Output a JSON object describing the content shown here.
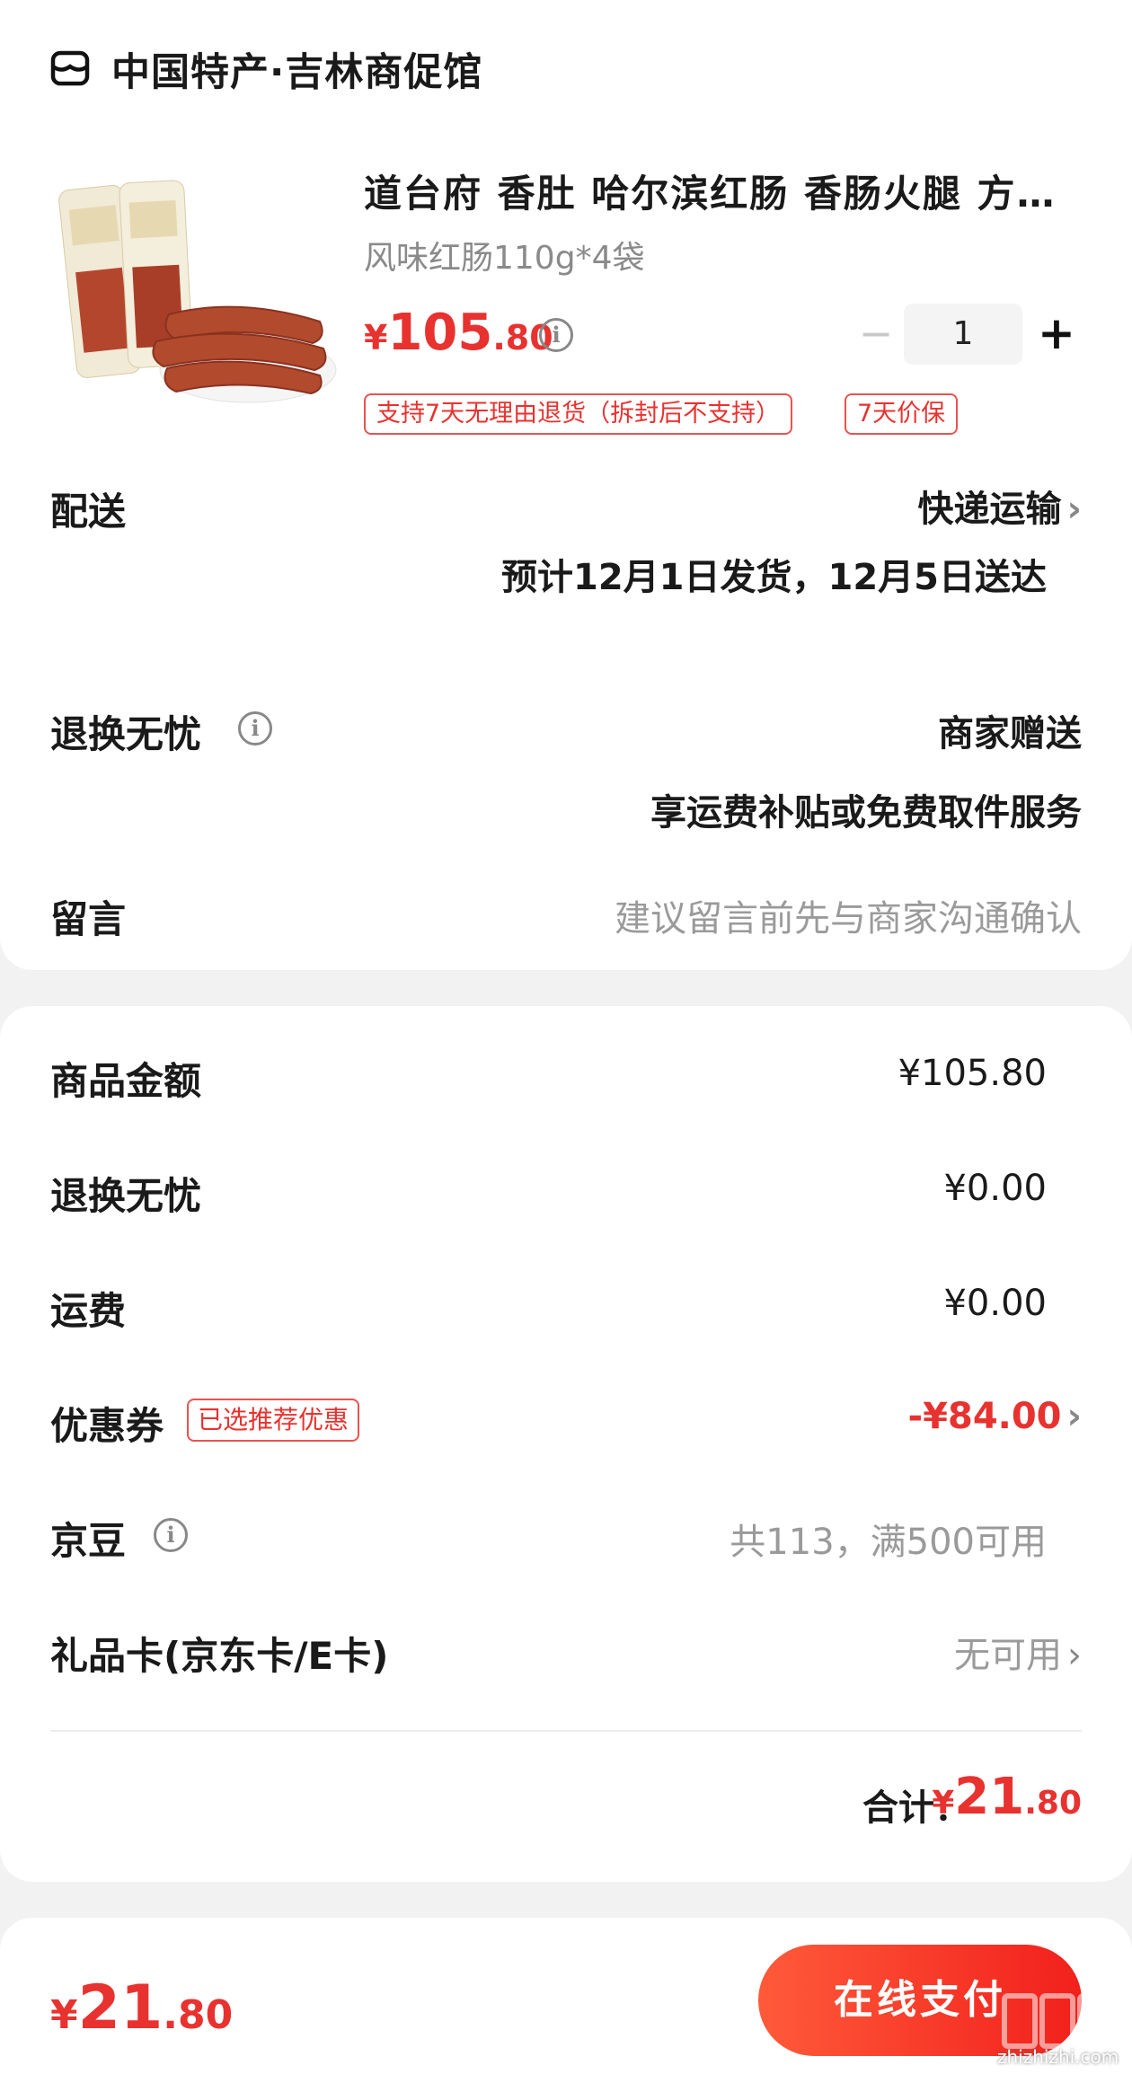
{
  "store": {
    "name": "中国特产·吉林商促馆",
    "icon": "shop-icon"
  },
  "product": {
    "title": "道台府 香肚 哈尔滨红肠 香肠火腿 方…",
    "spec": "风味红肠110g*4袋",
    "price_symbol": "¥",
    "price_int": "105",
    "price_dec": ".80",
    "quantity": "1",
    "minus_label": "−",
    "plus_label": "+",
    "tags": [
      "支持7天无理由退货（拆封后不支持）",
      "7天价保"
    ]
  },
  "delivery": {
    "label": "配送",
    "method": "快递运输",
    "estimate": "预计12月1日发货，12月5日送达"
  },
  "return_service": {
    "label": "退换无忧",
    "value": "商家赠送",
    "desc": "享运费补贴或免费取件服务"
  },
  "message": {
    "label": "留言",
    "placeholder": "建议留言前先与商家沟通确认"
  },
  "summary": {
    "items": [
      {
        "label": "商品金额",
        "value": "¥105.80"
      },
      {
        "label": "退换无忧",
        "value": "¥0.00"
      },
      {
        "label": "运费",
        "value": "¥0.00"
      },
      {
        "label": "优惠券",
        "badge": "已选推荐优惠",
        "value": "-¥84.00"
      },
      {
        "label": "京豆",
        "value": "共113，满500可用"
      },
      {
        "label": "礼品卡(京东卡/E卡)",
        "value": "无可用"
      }
    ],
    "total_label": "合计：",
    "total_symbol": "¥",
    "total_int": "21",
    "total_dec": ".80"
  },
  "footer": {
    "price_symbol": "¥",
    "price_int": "21",
    "price_dec": ".80",
    "pay_label": "在线支付",
    "watermark_text": "zhizhizhi.com"
  },
  "colors": {
    "accent": "#e8322f",
    "muted": "#8a8a8a"
  }
}
